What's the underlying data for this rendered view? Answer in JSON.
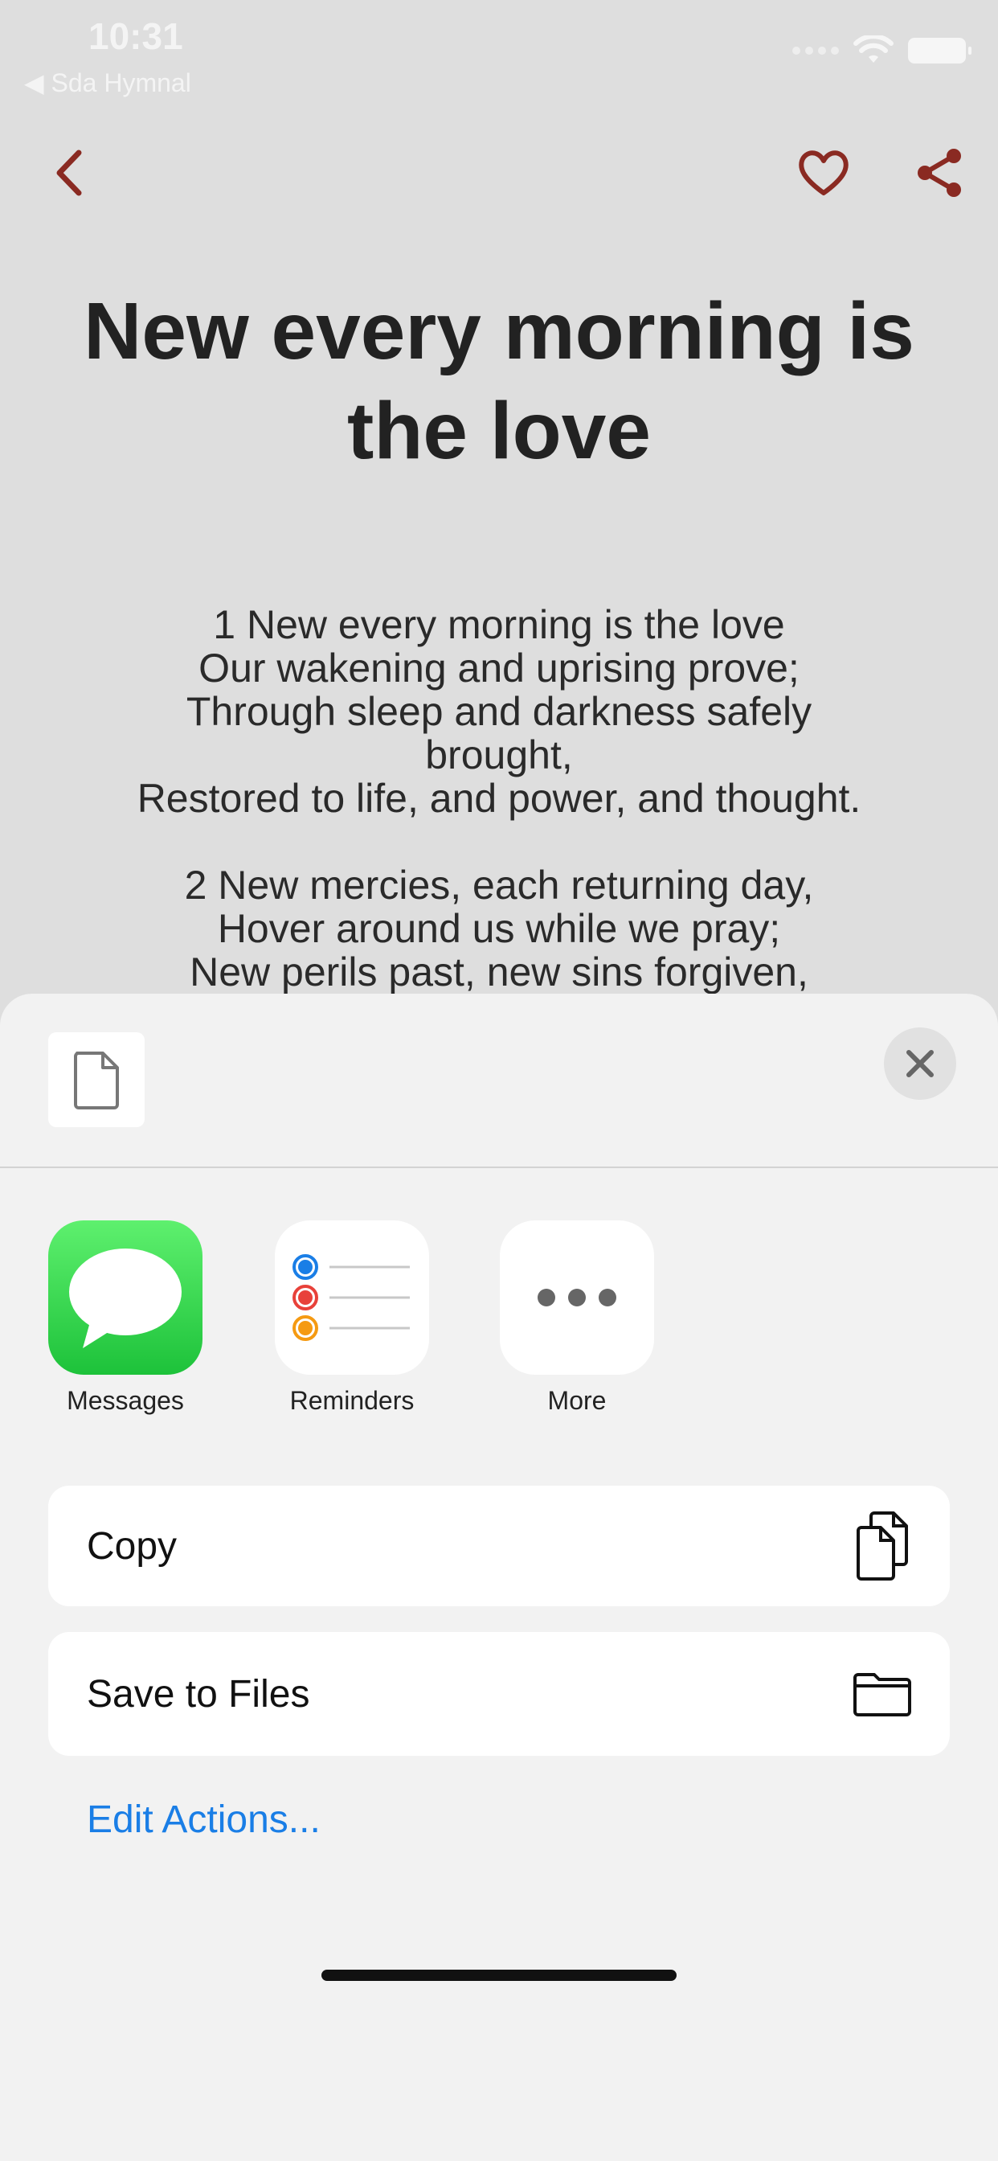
{
  "status_bar": {
    "time": "10:31",
    "back_app": "◀ Sda Hymnal"
  },
  "hymn": {
    "title": "New every morning is the love",
    "lyrics": [
      "1 New every morning is the love",
      "Our wakening and uprising prove;",
      "Through sleep and darkness safely",
      "brought,",
      "Restored to life, and power, and thought.",
      "",
      "2 New mercies, each returning day,",
      "Hover around us while we pray;",
      "New perils past, new sins forgiven,"
    ]
  },
  "share_sheet": {
    "apps": [
      {
        "label": "Messages",
        "icon": "messages-icon"
      },
      {
        "label": "Reminders",
        "icon": "reminders-icon"
      },
      {
        "label": "More",
        "icon": "more-icon"
      }
    ],
    "actions": [
      {
        "label": "Copy",
        "icon": "copy-icon"
      },
      {
        "label": "Save to Files",
        "icon": "folder-icon"
      }
    ],
    "edit_actions": "Edit Actions..."
  },
  "colors": {
    "accent_nav": "#8a2a22",
    "link_blue": "#1a7ee6",
    "messages_green": "#1dc23a"
  }
}
